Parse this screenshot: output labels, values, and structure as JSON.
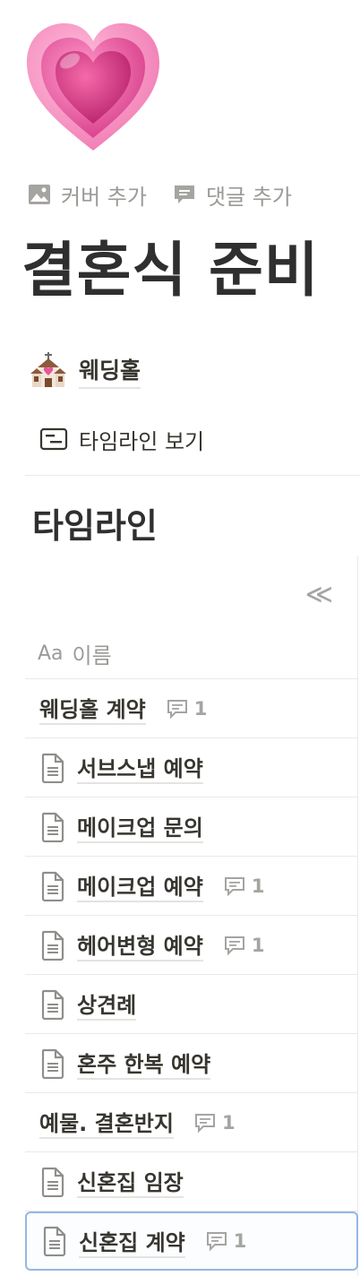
{
  "page": {
    "icon": "heart-emoji",
    "actions": [
      {
        "icon": "image-icon",
        "label": "커버 추가"
      },
      {
        "icon": "comment-icon",
        "label": "댓글 추가"
      }
    ],
    "title": "결혼식 준비"
  },
  "link": {
    "icon": "wedding-chapel-emoji",
    "label": "웨딩홀"
  },
  "view": {
    "icon": "timeline-icon",
    "label": "타임라인 보기"
  },
  "section": {
    "title": "타임라인"
  },
  "table": {
    "collapse_icon": "double-chevron-left-icon",
    "collapse_glyph": "≪",
    "header": {
      "type_icon": "Aa",
      "label": "이름"
    },
    "rows": [
      {
        "title": "웨딩홀 계약",
        "doc_icon": false,
        "comments": "1"
      },
      {
        "title": "서브스냅 예약",
        "doc_icon": true,
        "comments": ""
      },
      {
        "title": "메이크업 문의",
        "doc_icon": true,
        "comments": ""
      },
      {
        "title": "메이크업 예약",
        "doc_icon": true,
        "comments": "1"
      },
      {
        "title": "헤어변형 예약",
        "doc_icon": true,
        "comments": "1"
      },
      {
        "title": "상견례",
        "doc_icon": true,
        "comments": ""
      },
      {
        "title": "혼주 한복 예약",
        "doc_icon": true,
        "comments": ""
      },
      {
        "title": "예물. 결혼반지",
        "doc_icon": false,
        "comments": "1"
      },
      {
        "title": "신혼집 임장",
        "doc_icon": true,
        "comments": ""
      },
      {
        "title": "신혼집 계약",
        "doc_icon": true,
        "comments": "1",
        "selected": true
      }
    ]
  },
  "colors": {
    "text": "#37352f",
    "muted": "#9b9a97",
    "selection_border": "#94b7e6",
    "heart_pink": "#e8559a"
  }
}
